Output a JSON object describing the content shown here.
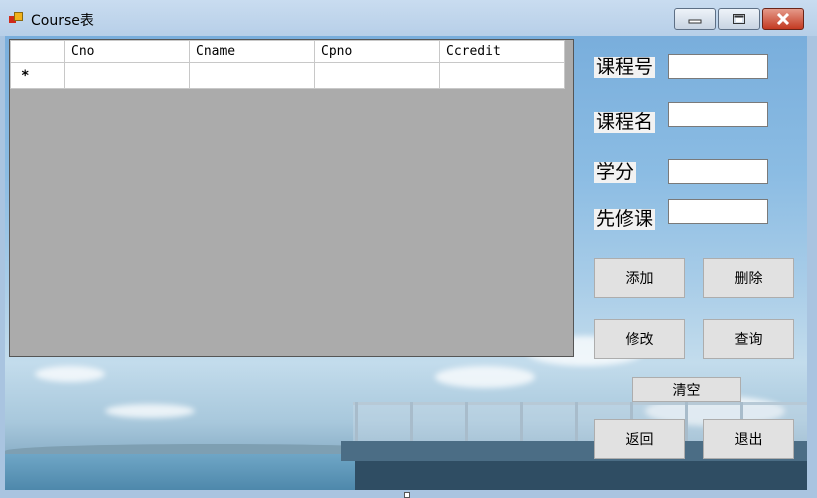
{
  "window": {
    "title": "Course表"
  },
  "grid": {
    "columns": [
      "Cno",
      "Cname",
      "Cpno",
      "Ccredit"
    ],
    "new_row_marker": "*"
  },
  "form": {
    "course_no_label": "课程号",
    "course_name_label": "课程名",
    "credit_label": "学分",
    "prereq_label": "先修课",
    "course_no_value": "",
    "course_name_value": "",
    "credit_value": "",
    "prereq_value": ""
  },
  "buttons": {
    "add": "添加",
    "delete": "删除",
    "modify": "修改",
    "query": "查询",
    "clear": "清空",
    "back": "返回",
    "exit": "退出"
  },
  "colors": {
    "grid_background": "#ababab",
    "close_button": "#c33a22",
    "button_face": "#e1e1e1"
  }
}
